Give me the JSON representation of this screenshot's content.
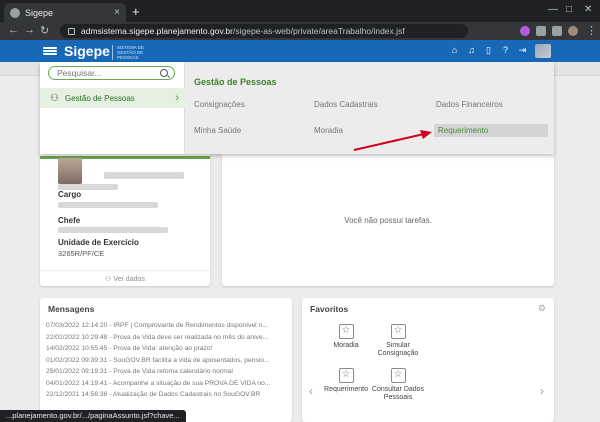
{
  "browser": {
    "tab_title": "Sigepe",
    "tab_close": "×",
    "new_tab": "+",
    "url_host": "admsistema.sigepe.planejamento.gov.br",
    "url_path": "/sigepe-as-web/private/areaTrabalho/index.jsf",
    "status_url": "...planejamento.gov.br/.../paginaAssunto.jsf?chave..."
  },
  "header": {
    "brand": "Sigepe",
    "brand_sub": "SISTEMA DE GESTÃO DE PESSOAS"
  },
  "menu": {
    "search_placeholder": "Pesquisar...",
    "left_item": "Gestão de Pessoas",
    "title": "Gestão de Pessoas",
    "links": [
      "Consignações",
      "Dados Cadastrais",
      "Dados Financeiros",
      "Minha Saúde",
      "Moradia",
      "Requerimento"
    ]
  },
  "profile": {
    "cargo_label": "Cargo",
    "chefe_label": "Chefe",
    "unidade_label": "Unidade de Exercício",
    "unidade_value": "3265R/PF/CE",
    "ver_dados": "Ver dados"
  },
  "tasks": {
    "empty": "Você não possui tarefas."
  },
  "messages": {
    "title": "Mensagens",
    "items": [
      "07/03/2022 12:14:20 - IRPF | Comprovante de Rendimentos disponível n...",
      "22/02/2022 10:29:48 - Prova de Vida deve ser realizada no mês do anive...",
      "14/02/2022 10:55:45 - Prova de Vida: atenção ao prazo!",
      "01/02/2022 09:39:31 - SouGOV.BR facilita a vida de aposentados, pensio...",
      "25/01/2022 09:19:31 - Prova de Vida retoma calendário normal",
      "04/01/2022 14:19:41 - Acompanhe a situação de sua PROVA DE VIDA no...",
      "22/12/2021 14:56:36 - Atualização de Dados Cadastrais no SouGOV.BR"
    ]
  },
  "favorites": {
    "title": "Favoritos",
    "items": [
      "Moradia",
      "Simular Consignação",
      "Requerimento",
      "Consultar Dados Pessoais"
    ]
  },
  "colors": {
    "header_blue": "#1769b8",
    "accent_green": "#4c9a3f",
    "arrow_red": "#d0021b"
  }
}
